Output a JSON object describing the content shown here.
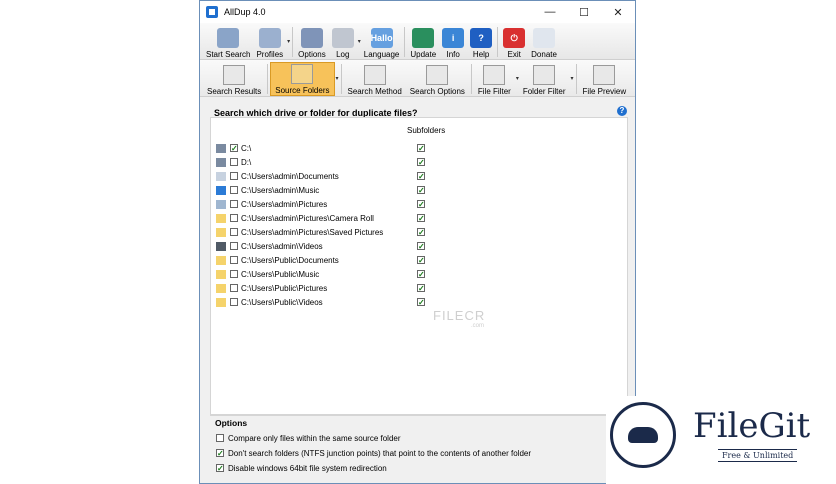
{
  "window": {
    "title": "AllDup 4.0",
    "controls": {
      "minimize": "—",
      "maximize": "☐",
      "close": "✕"
    }
  },
  "toolbar": [
    {
      "name": "start-search-button",
      "label": "Start Search",
      "icon": "magnifier-icon",
      "color": "#8aa4c8",
      "dropdown": false
    },
    {
      "name": "profiles-button",
      "label": "Profiles",
      "icon": "profile-icon",
      "color": "#9bb0cf",
      "dropdown": true
    },
    {
      "name": "options-button",
      "label": "Options",
      "icon": "options-icon",
      "color": "#7f94b8",
      "dropdown": false
    },
    {
      "name": "log-button",
      "label": "Log",
      "icon": "log-icon",
      "color": "#c0c6d0",
      "dropdown": true
    },
    {
      "name": "language-button",
      "label": "Language",
      "icon": "language-icon",
      "color": "#66a0e0",
      "dropdown": false,
      "glyph": "Hallo"
    },
    {
      "name": "update-button",
      "label": "Update",
      "icon": "globe-icon",
      "color": "#2a8f5e",
      "dropdown": false
    },
    {
      "name": "info-button",
      "label": "Info",
      "icon": "info-icon",
      "color": "#3b86d6",
      "dropdown": false,
      "glyph": "i"
    },
    {
      "name": "help-button",
      "label": "Help",
      "icon": "help-icon",
      "color": "#1f5fc2",
      "dropdown": false,
      "glyph": "?"
    },
    {
      "name": "exit-button",
      "label": "Exit",
      "icon": "power-icon",
      "color": "#d93030",
      "dropdown": false,
      "glyph": "⏻"
    },
    {
      "name": "donate-button",
      "label": "Donate",
      "icon": "paypal-icon",
      "color": "#e0e6ee",
      "dropdown": false
    }
  ],
  "tabs": [
    {
      "name": "tab-search-results",
      "label": "Search Results",
      "active": false,
      "dropdown": false
    },
    {
      "name": "tab-source-folders",
      "label": "Source Folders",
      "active": true,
      "dropdown": true
    },
    {
      "name": "tab-search-method",
      "label": "Search Method",
      "active": false,
      "dropdown": false
    },
    {
      "name": "tab-search-options",
      "label": "Search Options",
      "active": false,
      "dropdown": false
    },
    {
      "name": "tab-file-filter",
      "label": "File Filter",
      "active": false,
      "dropdown": true
    },
    {
      "name": "tab-folder-filter",
      "label": "Folder Filter",
      "active": false,
      "dropdown": true
    },
    {
      "name": "tab-file-preview",
      "label": "File Preview",
      "active": false,
      "dropdown": false
    }
  ],
  "source": {
    "heading": "Search which drive or folder for duplicate files?",
    "subfolders_header": "Subfolders",
    "rows": [
      {
        "path": "C:\\",
        "checked": true,
        "subfolders": true,
        "icon": "drive-icon"
      },
      {
        "path": "D:\\",
        "checked": false,
        "subfolders": true,
        "icon": "drive-icon"
      },
      {
        "path": "C:\\Users\\admin\\Documents",
        "checked": false,
        "subfolders": true,
        "icon": "documents-icon"
      },
      {
        "path": "C:\\Users\\admin\\Music",
        "checked": false,
        "subfolders": true,
        "icon": "music-icon"
      },
      {
        "path": "C:\\Users\\admin\\Pictures",
        "checked": false,
        "subfolders": true,
        "icon": "pictures-icon"
      },
      {
        "path": "C:\\Users\\admin\\Pictures\\Camera Roll",
        "checked": false,
        "subfolders": true,
        "icon": "folder-icon"
      },
      {
        "path": "C:\\Users\\admin\\Pictures\\Saved Pictures",
        "checked": false,
        "subfolders": true,
        "icon": "folder-icon"
      },
      {
        "path": "C:\\Users\\admin\\Videos",
        "checked": false,
        "subfolders": true,
        "icon": "videos-icon"
      },
      {
        "path": "C:\\Users\\Public\\Documents",
        "checked": false,
        "subfolders": true,
        "icon": "folder-icon"
      },
      {
        "path": "C:\\Users\\Public\\Music",
        "checked": false,
        "subfolders": true,
        "icon": "folder-icon"
      },
      {
        "path": "C:\\Users\\Public\\Pictures",
        "checked": false,
        "subfolders": true,
        "icon": "folder-icon"
      },
      {
        "path": "C:\\Users\\Public\\Videos",
        "checked": false,
        "subfolders": true,
        "icon": "folder-icon"
      }
    ]
  },
  "options": {
    "title": "Options",
    "items": [
      {
        "label": "Compare only files within the same source folder",
        "checked": false
      },
      {
        "label": "Don't search folders (NTFS junction points) that point to the contents of another folder",
        "checked": true
      },
      {
        "label": "Disable windows 64bit file system redirection",
        "checked": true
      }
    ]
  },
  "watermark": {
    "text": "FILECR",
    "sub": ".com"
  },
  "brand": {
    "name": "FileGit",
    "tagline": "Free & Unlimited"
  }
}
